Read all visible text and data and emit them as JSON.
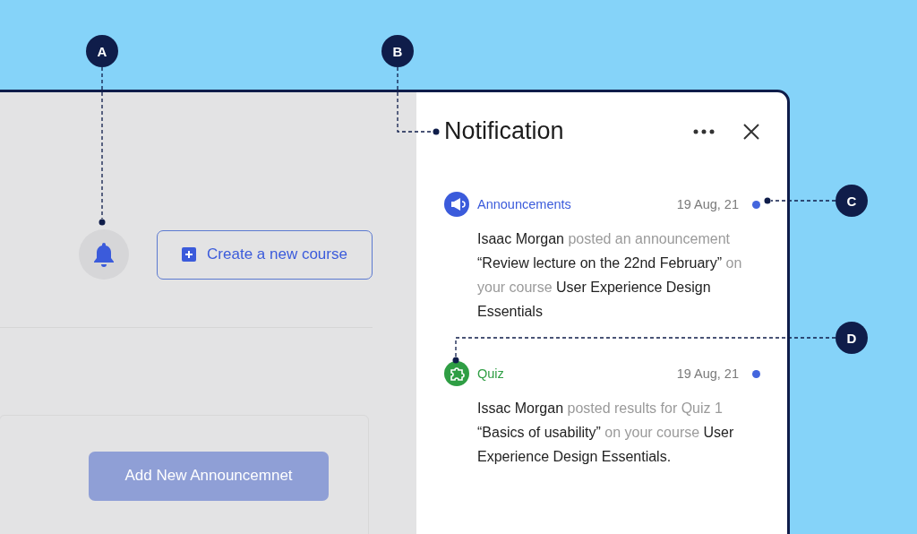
{
  "toolbar": {
    "create_button": "Create a new course"
  },
  "announcement_card": {
    "add_button": {
      "label": "Add New Announcemnet",
      "disabled": true
    }
  },
  "notification_panel": {
    "title": "Notification",
    "items": [
      {
        "kind": "announcement",
        "category": "Announcements",
        "color": "#3b5bdb",
        "date": "19 Aug, 21",
        "unread": true,
        "text": "**Isaac Morgan** posted an announcement **“Review lecture on the 22nd February”** on your course **User Experience Design Essentials**"
      },
      {
        "kind": "quiz",
        "category": "Quiz",
        "color": "#2f9e44",
        "date": "19 Aug, 21",
        "unread": true,
        "text": "**Issac Morgan** posted results for Quiz 1 **“Basics of usability”** on your course **User Experience Design Essentials.**"
      }
    ]
  },
  "annotations": [
    {
      "label": "A"
    },
    {
      "label": "B"
    },
    {
      "label": "C"
    },
    {
      "label": "D"
    }
  ]
}
